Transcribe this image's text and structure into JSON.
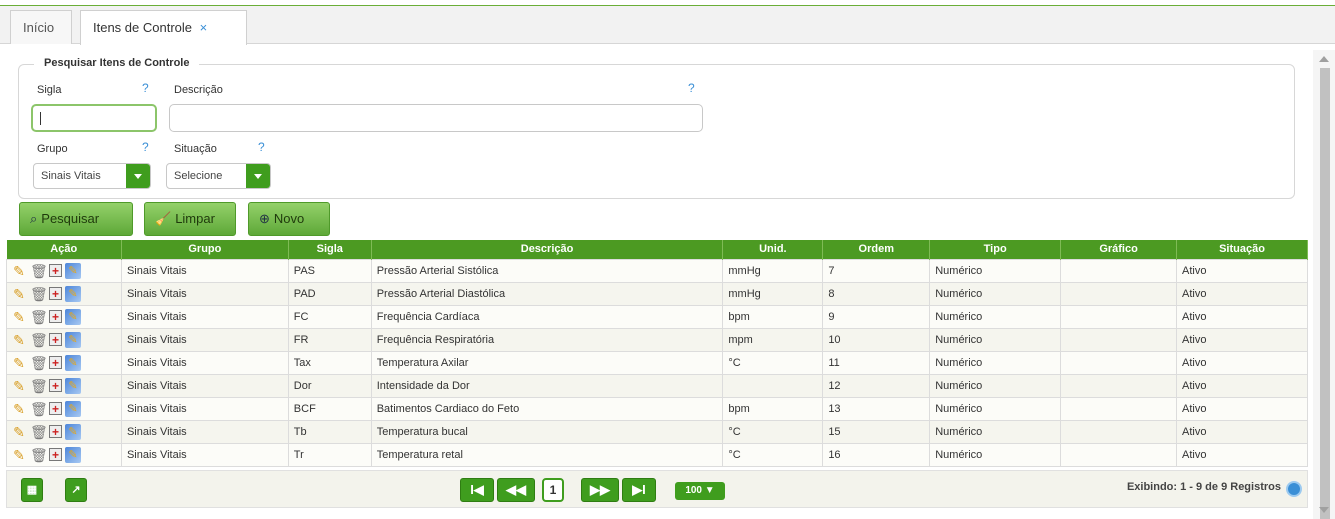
{
  "tabs": [
    {
      "label": "Início"
    },
    {
      "label": "Itens de Controle",
      "close": "×"
    }
  ],
  "search": {
    "legend": "Pesquisar Itens de Controle",
    "help": "?",
    "sigla_label": "Sigla",
    "sigla_value": "",
    "descricao_label": "Descrição",
    "descricao_value": "",
    "grupo_label": "Grupo",
    "grupo_value": "Sinais Vitais",
    "situacao_label": "Situação",
    "situacao_value": "Selecione"
  },
  "buttons": {
    "pesquisar": "Pesquisar",
    "limpar": "Limpar",
    "novo": "Novo"
  },
  "table": {
    "headers": [
      "Ação",
      "Grupo",
      "Sigla",
      "Descrição",
      "Unid.",
      "Ordem",
      "Tipo",
      "Gráfico",
      "Situação"
    ],
    "rows": [
      {
        "grupo": "Sinais Vitais",
        "sigla": "PAS",
        "descricao": "Pressão Arterial Sistólica",
        "unid": "mmHg",
        "ordem": "7",
        "tipo": "Numérico",
        "grafico": "",
        "situacao": "Ativo"
      },
      {
        "grupo": "Sinais Vitais",
        "sigla": "PAD",
        "descricao": "Pressão Arterial Diastólica",
        "unid": "mmHg",
        "ordem": "8",
        "tipo": "Numérico",
        "grafico": "",
        "situacao": "Ativo"
      },
      {
        "grupo": "Sinais Vitais",
        "sigla": "FC",
        "descricao": "Frequência Cardíaca",
        "unid": "bpm",
        "ordem": "9",
        "tipo": "Numérico",
        "grafico": "",
        "situacao": "Ativo"
      },
      {
        "grupo": "Sinais Vitais",
        "sigla": "FR",
        "descricao": "Frequência Respiratória",
        "unid": "mpm",
        "ordem": "10",
        "tipo": "Numérico",
        "grafico": "",
        "situacao": "Ativo"
      },
      {
        "grupo": "Sinais Vitais",
        "sigla": "Tax",
        "descricao": "Temperatura Axilar",
        "unid": "°C",
        "ordem": "11",
        "tipo": "Numérico",
        "grafico": "",
        "situacao": "Ativo"
      },
      {
        "grupo": "Sinais Vitais",
        "sigla": "Dor",
        "descricao": "Intensidade da Dor",
        "unid": "",
        "ordem": "12",
        "tipo": "Numérico",
        "grafico": "",
        "situacao": "Ativo"
      },
      {
        "grupo": "Sinais Vitais",
        "sigla": "BCF",
        "descricao": "Batimentos Cardiaco do Feto",
        "unid": "bpm",
        "ordem": "13",
        "tipo": "Numérico",
        "grafico": "",
        "situacao": "Ativo"
      },
      {
        "grupo": "Sinais Vitais",
        "sigla": "Tb",
        "descricao": "Temperatura bucal",
        "unid": "°C",
        "ordem": "15",
        "tipo": "Numérico",
        "grafico": "",
        "situacao": "Ativo"
      },
      {
        "grupo": "Sinais Vitais",
        "sigla": "Tr",
        "descricao": "Temperatura retal",
        "unid": "°C",
        "ordem": "16",
        "tipo": "Numérico",
        "grafico": "",
        "situacao": "Ativo"
      }
    ]
  },
  "pager": {
    "first": "I◀",
    "prev": "◀◀",
    "page": "1",
    "next": "▶▶",
    "last": "▶I",
    "page_size": "100 ▼",
    "info": "Exibindo: 1 - 9 de 9 Registros"
  },
  "colors": {
    "accent": "#4c9a22",
    "help": "#3a8fd6"
  },
  "icons": [
    "pencil-icon",
    "trash-icon",
    "add-box-icon",
    "report-icon",
    "search-icon",
    "broom-icon",
    "plus-circle-icon",
    "grid-icon",
    "export-icon",
    "refresh-icon"
  ]
}
